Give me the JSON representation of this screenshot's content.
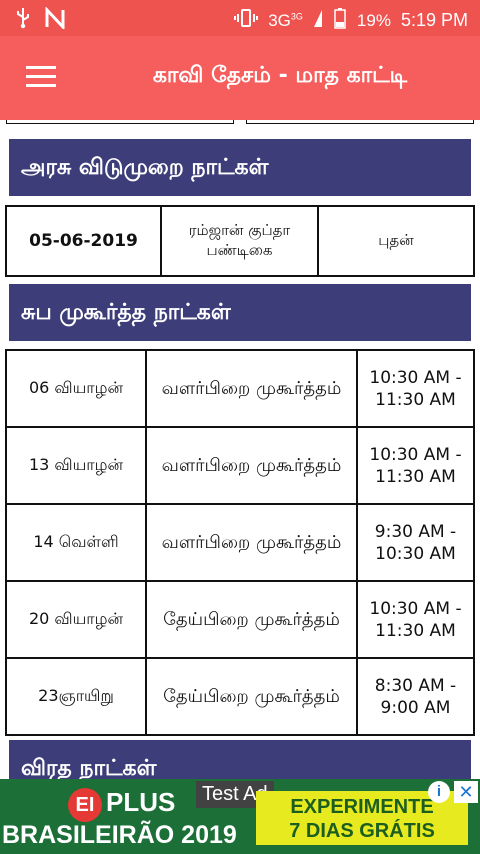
{
  "status_bar": {
    "network": "3G",
    "network_super": "3G",
    "battery": "19%",
    "time": "5:19 PM",
    "icons": [
      "usb-icon",
      "n-icon",
      "vibrate-icon",
      "signal-icon",
      "battery-icon"
    ]
  },
  "app_bar": {
    "title": "காவி தேசம் - மாத காட்டி",
    "menu_icon": "hamburger-icon"
  },
  "holidays": {
    "title": "அரசு விடுமுறை நாட்கள்",
    "rows": [
      {
        "date": "05-06-2019",
        "name": "ரம்ஜான் குப்தா பண்டிகை",
        "day": "புதன்"
      }
    ]
  },
  "muhurtham": {
    "title": "சுப முகூர்த்த நாட்கள்",
    "rows": [
      {
        "day": "06 வியாழன்",
        "type": "வளர்பிறை முகூர்த்தம்",
        "time": "10:30 AM - 11:30 AM"
      },
      {
        "day": "13 வியாழன்",
        "type": "வளர்பிறை முகூர்த்தம்",
        "time": "10:30 AM - 11:30 AM"
      },
      {
        "day": "14 வெள்ளி",
        "type": "வளர்பிறை முகூர்த்தம்",
        "time": "9:30 AM - 10:30 AM"
      },
      {
        "day": "20 வியாழன்",
        "type": "தேய்பிறை முகூர்த்தம்",
        "time": "10:30 AM - 11:30 AM"
      },
      {
        "day": "23ஞாயிறு",
        "type": "தேய்பிறை முகூர்த்தம்",
        "time": "8:30 AM - 9:00 AM"
      }
    ]
  },
  "fasting": {
    "title": "விரத நாட்கள்"
  },
  "ad": {
    "badge": "Test Ad",
    "logo_mark": "EI",
    "logo_text": "PLUS",
    "subtitle": "BRASILEIRÃO 2019",
    "cta_line1": "EXPERIMENTE",
    "cta_line2": "7 DIAS GRÁTIS",
    "info_glyph": "i",
    "close_glyph": "✕"
  },
  "colors": {
    "status_bar": "#ef5350",
    "app_bar": "#f65e5e",
    "section_header": "#3d3d7a",
    "ad_bg": "#1b6f37",
    "ad_cta": "#e6ea1f"
  }
}
